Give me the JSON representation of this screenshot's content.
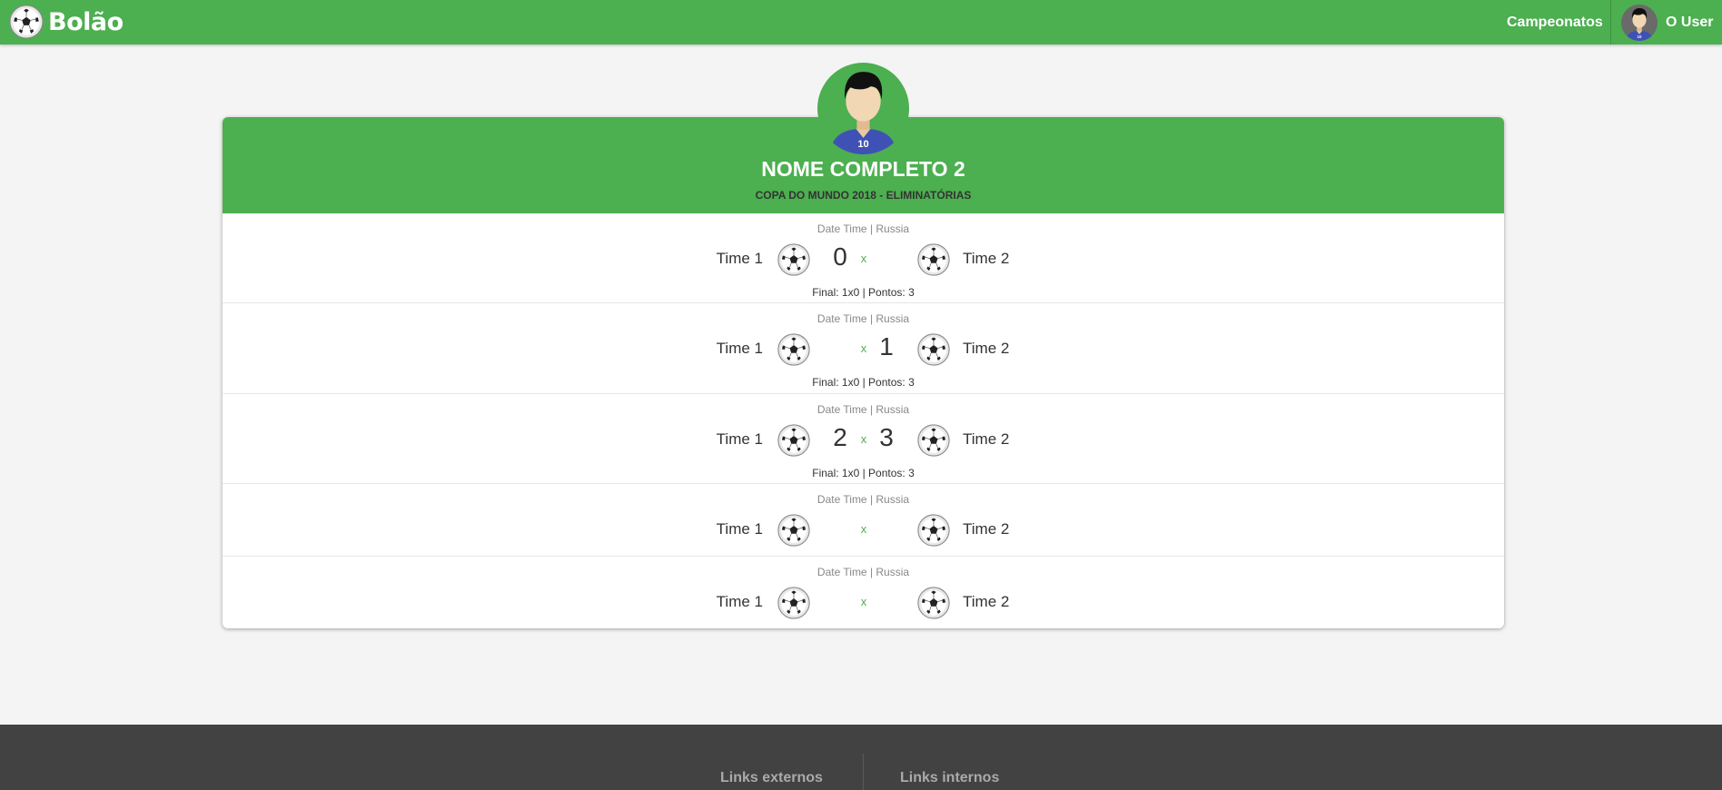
{
  "navbar": {
    "brand": "Bolão",
    "links": [
      "Campeonatos"
    ],
    "user_name": "O User"
  },
  "profile": {
    "name": "NOME COMPLETO 2",
    "competition": "COPA DO MUNDO 2018 - ELIMINATÓRIAS",
    "jersey_number": "10"
  },
  "matches": [
    {
      "info": "Date Time | Russia",
      "team1": "Time 1",
      "team2": "Time 2",
      "score1": "0",
      "score2": "",
      "x": "x",
      "result": "Final: 1x0 | Pontos: 3"
    },
    {
      "info": "Date Time | Russia",
      "team1": "Time 1",
      "team2": "Time 2",
      "score1": "",
      "score2": "1",
      "x": "x",
      "result": "Final: 1x0 | Pontos: 3"
    },
    {
      "info": "Date Time | Russia",
      "team1": "Time 1",
      "team2": "Time 2",
      "score1": "2",
      "score2": "3",
      "x": "x",
      "result": "Final: 1x0 | Pontos: 3"
    },
    {
      "info": "Date Time | Russia",
      "team1": "Time 1",
      "team2": "Time 2",
      "score1": "",
      "score2": "",
      "x": "x",
      "result": ""
    },
    {
      "info": "Date Time | Russia",
      "team1": "Time 1",
      "team2": "Time 2",
      "score1": "",
      "score2": "",
      "x": "x",
      "result": ""
    }
  ],
  "footer": {
    "external": "Links externos",
    "internal": "Links internos"
  },
  "colors": {
    "primary": "#4caf50",
    "background": "#f4f4f4",
    "footer": "#424242",
    "jersey": "#3f51b5"
  }
}
